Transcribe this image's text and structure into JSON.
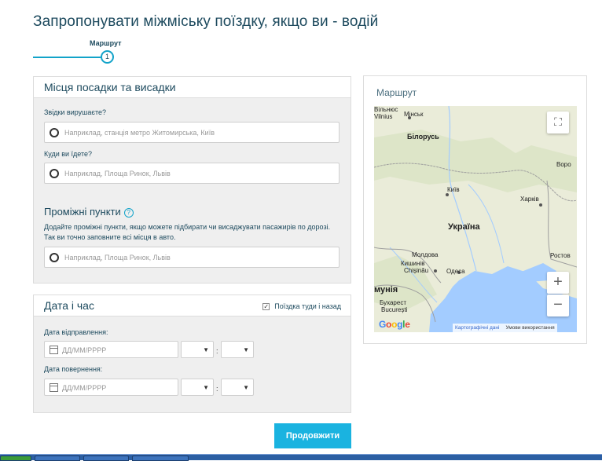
{
  "page": {
    "title": "Запропонувати міжміську поїздку, якщо ви - водій"
  },
  "stepper": {
    "step_label": "Маршрут",
    "step_number": "1"
  },
  "route_panel": {
    "title": "Місця посадки та висадки",
    "from_label": "Звідки вирушаєте?",
    "from_placeholder": "Наприклад, станція метро Житомирська, Київ",
    "to_label": "Куди ви їдете?",
    "to_placeholder": "Наприклад, Площа Ринок, Львів",
    "stops_title": "Проміжні пункти",
    "stops_help_icon": "?",
    "stops_hint": "Додайте проміжні пункти, якщо можете підбирати чи висаджувати пасажирів по дорозі. Так ви точно заповните всі місця в авто.",
    "stop_placeholder": "Наприклад, Площа Ринок, Львів"
  },
  "date_panel": {
    "title": "Дата і час",
    "roundtrip_label": "Поїздка туди і назад",
    "roundtrip_checked": true,
    "departure_label": "Дата відправлення:",
    "departure_placeholder": "ДД/ММ/РРРР",
    "return_label": "Дата повернення:",
    "return_placeholder": "ДД/ММ/РРРР",
    "time_separator": ":"
  },
  "continue_button": "Продовжити",
  "map": {
    "title": "Маршрут",
    "labels": {
      "vilnius": "Вільнюс",
      "vilnius_latin": "Vilnius",
      "minsk": "Мінськ",
      "belarus": "Білорусь",
      "voronezh": "Воро",
      "kyiv": "Київ",
      "kharkiv": "Харків",
      "ukraine": "Україна",
      "moldova": "Молдова",
      "chisinau": "Кишинів",
      "chisinau_latin": "Chișinău",
      "odesa": "Одеса",
      "rostov": "Ростов",
      "romania": "мунія",
      "bucharest": "Бухарест",
      "bucharest_latin": "București"
    },
    "fullscreen_icon": "⛶",
    "zoom_in": "+",
    "zoom_out": "−",
    "google": "Google",
    "map_data_link": "Картографічні дані",
    "terms_link": "Умови використання",
    "colors": {
      "land": "#eaecd9",
      "sea": "#a3ccff",
      "border": "#9e9e9e"
    }
  },
  "theme": {
    "accent": "#12a3c9",
    "button": "#1ab3e0",
    "title": "#1d4a5e"
  }
}
